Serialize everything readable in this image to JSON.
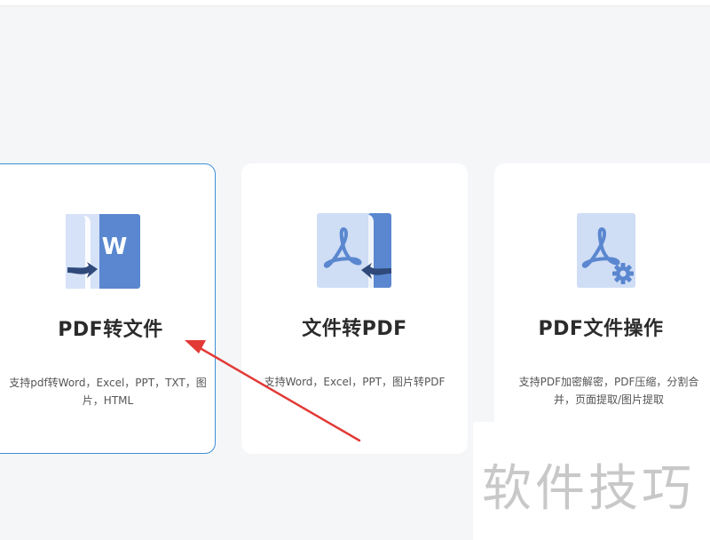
{
  "cards": [
    {
      "title": "PDF转文件",
      "description": "支持pdf转Word，Excel，PPT，TXT，图片，HTML",
      "icon": "pdf-to-word-icon",
      "selected": true
    },
    {
      "title": "文件转PDF",
      "description": "支持Word，Excel，PPT，图片转PDF",
      "icon": "file-to-pdf-icon",
      "selected": false
    },
    {
      "title": "PDF文件操作",
      "description": "支持PDF加密解密，PDF压缩，分割合并，页面提取/图片提取",
      "icon": "pdf-settings-icon",
      "selected": false
    }
  ],
  "watermark": "软件技巧",
  "colors": {
    "accent_blue": "#5a87cf",
    "light_blue": "#cfddf5",
    "selected_border": "#3f8fd8",
    "annotation_arrow": "#e23a36"
  }
}
